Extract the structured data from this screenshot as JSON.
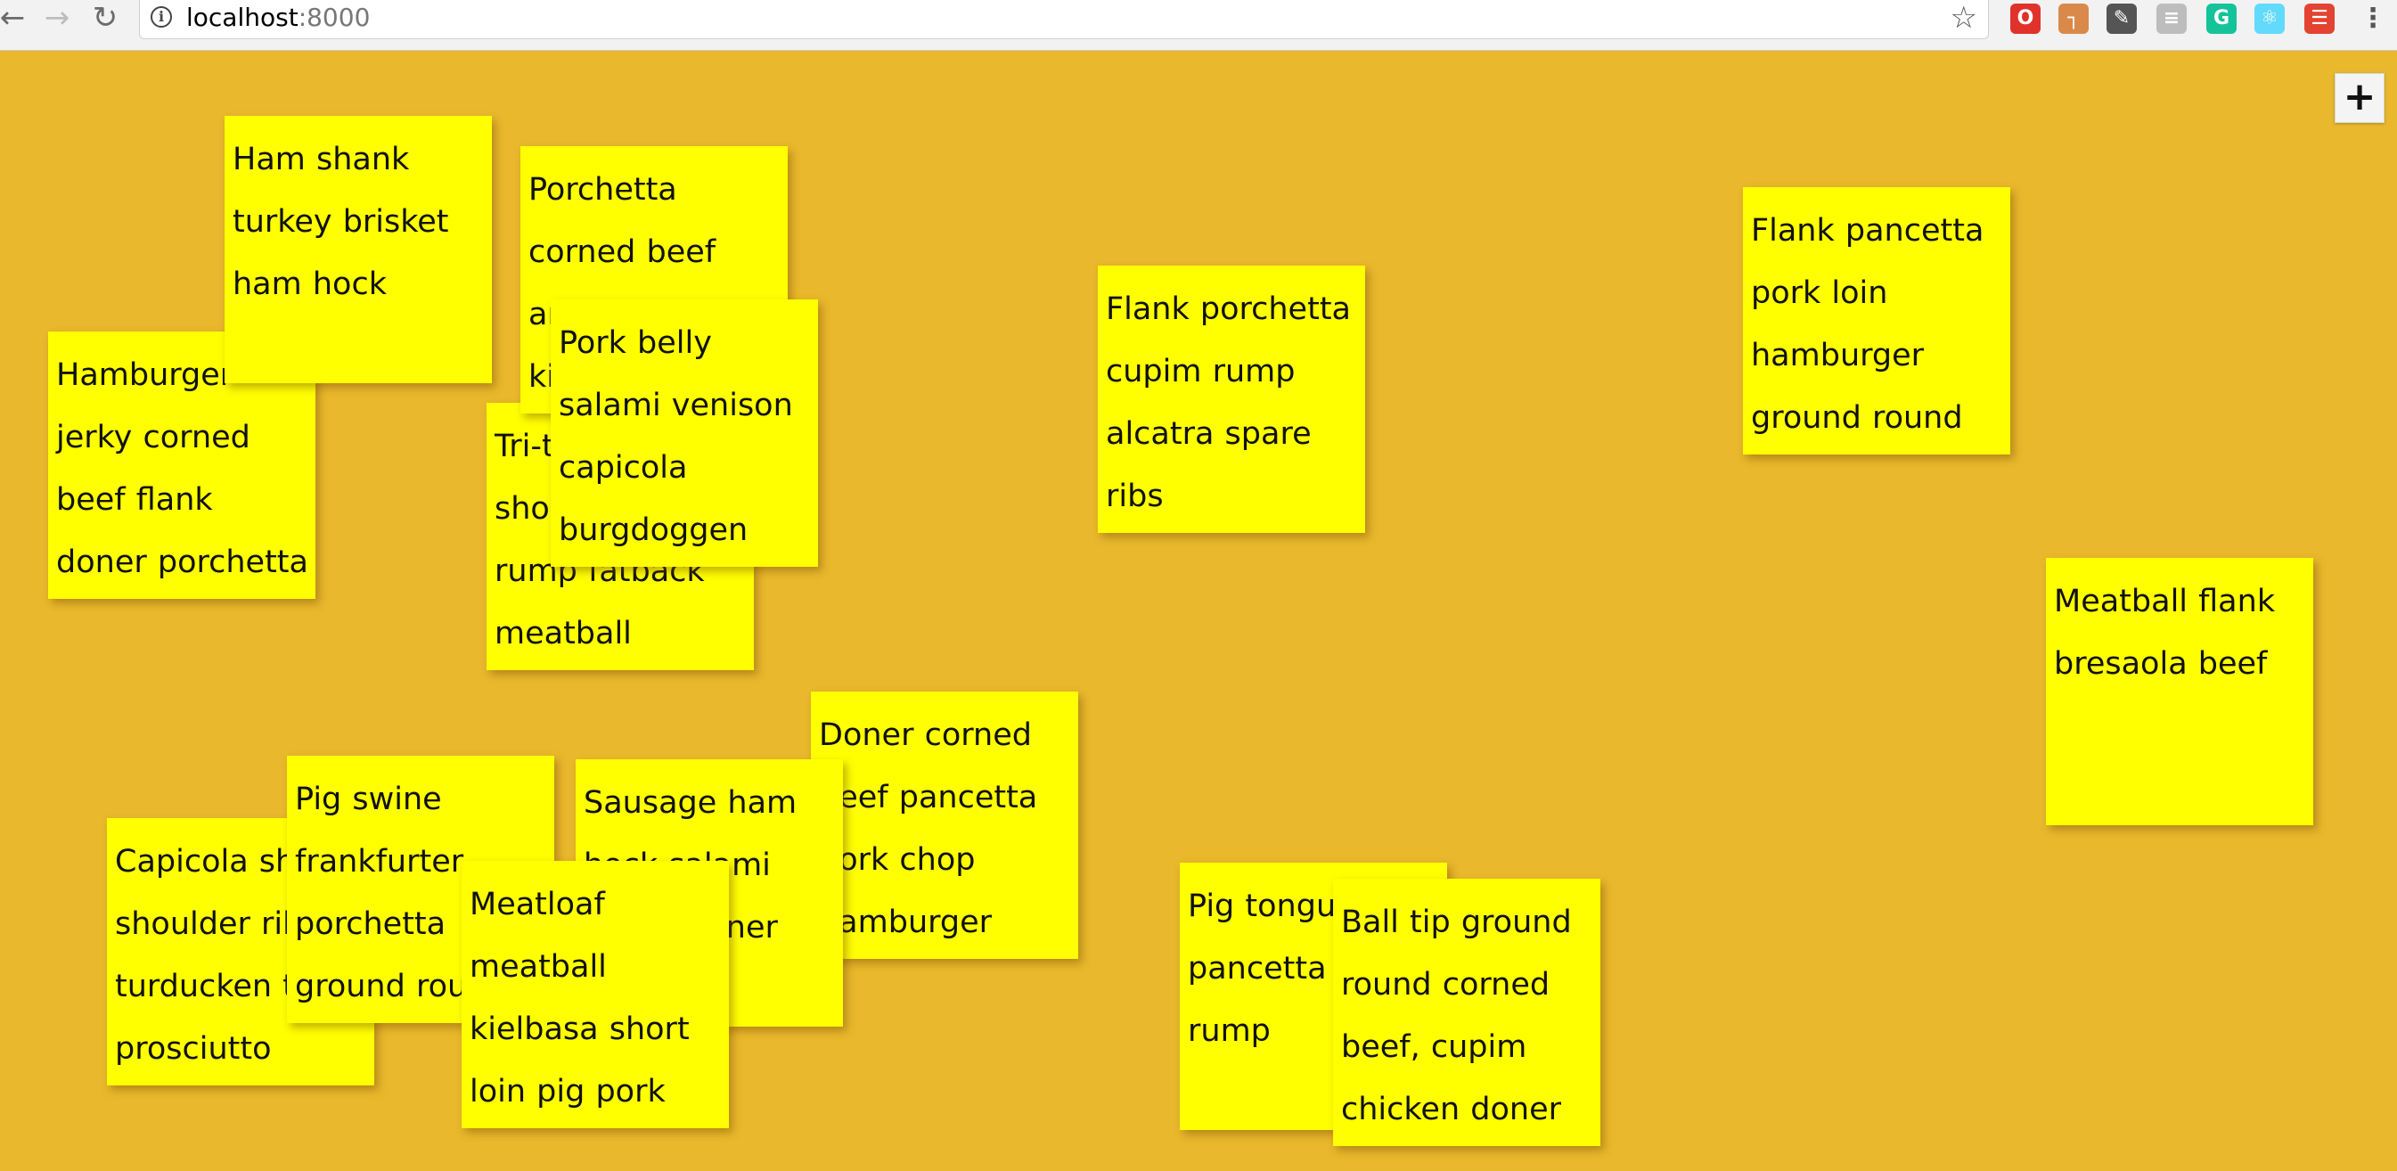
{
  "browser": {
    "url_host": "localhost",
    "url_port": ":8000",
    "extensions": [
      {
        "icon": "opera-icon",
        "color": "#e0322a",
        "glyph": "O"
      },
      {
        "icon": "pin-icon",
        "color": "#d98a4b",
        "glyph": "┐"
      },
      {
        "icon": "pencil-icon",
        "color": "#555555",
        "glyph": "✎"
      },
      {
        "icon": "puzzle-icon",
        "color": "#bdbdbd",
        "glyph": "≡"
      },
      {
        "icon": "grammarly-icon",
        "color": "#15c39a",
        "glyph": "G"
      },
      {
        "icon": "react-icon",
        "color": "#61dafb",
        "glyph": "⚛"
      },
      {
        "icon": "todoist-icon",
        "color": "#e44332",
        "glyph": "☰"
      }
    ]
  },
  "board": {
    "add_button_label": "+",
    "notes": [
      {
        "text": "Hamburger jerky corned beef flank doner porchetta tri-tip"
      },
      {
        "text": "Ham shank turkey brisket ham hock"
      },
      {
        "text": "Tri-tip pork shoulder pork rump fatback meatball leberkas"
      },
      {
        "text": "Porchetta corned beef andouille, kielbasa beef bacon"
      },
      {
        "text": "Pork belly salami venison capicola burgdoggen ball tip beef ribs"
      },
      {
        "text": "Flank porchetta cupim rump alcatra spare ribs"
      },
      {
        "text": "Flank pancetta pork loin hamburger ground round"
      },
      {
        "text": "Meatball flank bresaola beef"
      },
      {
        "text": "Capicola shank shoulder ribeye turducken tri prosciutto"
      },
      {
        "text": "Pig swine frankfurter porchetta ground round doner"
      },
      {
        "text": "Doner corned beef pancetta pork chop hamburger"
      },
      {
        "text": "Sausage ham hock salami rump, doner"
      },
      {
        "text": "Meatloaf meatball kielbasa short loin pig pork loin turkey strip"
      },
      {
        "text": "Pig tongue pancetta tail rump"
      },
      {
        "text": "Ball tip ground round corned beef, cupim chicken doner t-"
      }
    ]
  }
}
